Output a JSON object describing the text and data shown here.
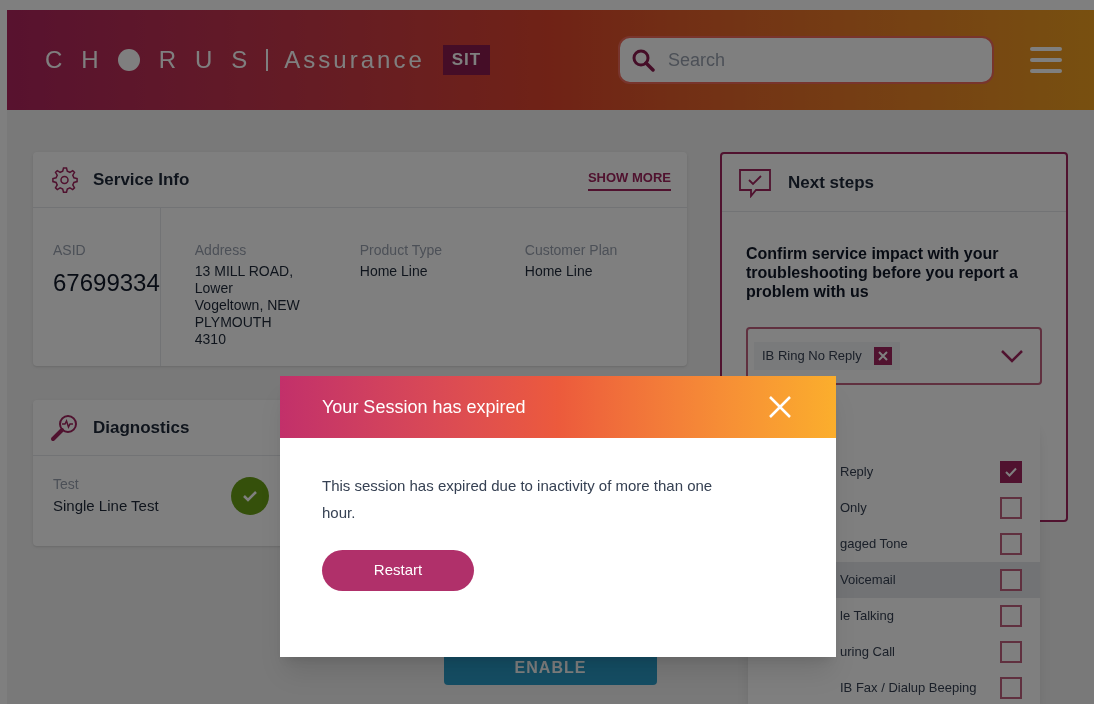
{
  "header": {
    "logo_left": "CH",
    "logo_right": "RUS",
    "product": "Assurance",
    "environment": "SIT",
    "search": {
      "placeholder": "Search"
    }
  },
  "service_info": {
    "title": "Service Info",
    "action": "SHOW MORE",
    "fields": [
      {
        "label": "ASID",
        "value": "67699334",
        "kind": "primary"
      },
      {
        "label": "Address",
        "value": "13 MILL ROAD,\nLower\nVogeltown, NEW\nPLYMOUTH\n4310",
        "kind": "detail"
      },
      {
        "label": "Product Type",
        "value": "Home Line",
        "kind": "detail"
      },
      {
        "label": "Customer Plan",
        "value": "Home Line",
        "kind": "detail"
      }
    ]
  },
  "diagnostics": {
    "title": "Diagnostics",
    "test_label": "Test",
    "test_value": "Single Line Test",
    "passed": true
  },
  "next_steps": {
    "title": "Next steps",
    "message": "Confirm service impact with your troubleshooting before you report a problem with us",
    "selected_tags": [
      {
        "label": "IB Ring No Reply"
      }
    ],
    "options": [
      {
        "label": "Reply",
        "checked": true,
        "highlighted": false
      },
      {
        "label": "Only",
        "checked": false,
        "highlighted": false
      },
      {
        "label": "gaged Tone",
        "checked": false,
        "highlighted": false
      },
      {
        "label": "Voicemail",
        "checked": false,
        "highlighted": true
      },
      {
        "label": "le Talking",
        "checked": false,
        "highlighted": false
      },
      {
        "label": "uring Call",
        "checked": false,
        "highlighted": false
      },
      {
        "label": "IB Fax / Dialup Beeping",
        "checked": false,
        "highlighted": false
      }
    ]
  },
  "enable_button": "ENABLE",
  "modal": {
    "title": "Your Session has expired",
    "message": "This session has expired due to inactivity of more than one hour.",
    "button": "Restart"
  }
}
